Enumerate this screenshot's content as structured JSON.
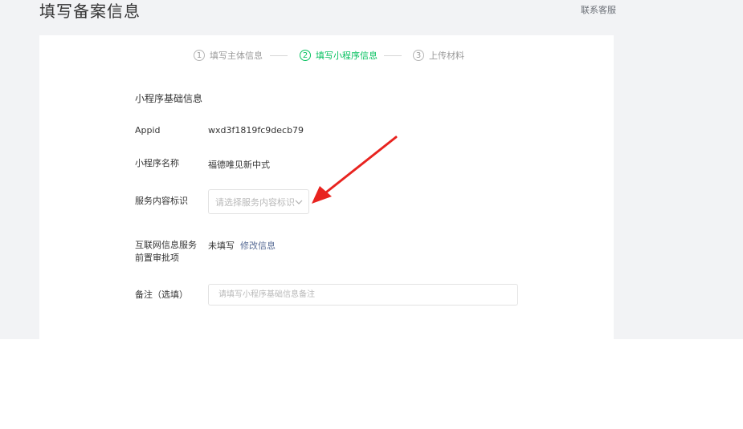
{
  "header": {
    "title": "填写备案信息",
    "contact_label": "联系客服"
  },
  "steps": [
    {
      "number": "1",
      "label": "填写主体信息",
      "active": false
    },
    {
      "number": "2",
      "label": "填写小程序信息",
      "active": true
    },
    {
      "number": "3",
      "label": "上传材料",
      "active": false
    }
  ],
  "section": {
    "title": "小程序基础信息"
  },
  "form": {
    "appid_label": "Appid",
    "appid_value": "wxd3f1819fc9decb79",
    "name_label": "小程序名称",
    "name_value": "福德唯见新中式",
    "service_label": "服务内容标识",
    "service_placeholder": "请选择服务内容标识",
    "preapproval_label_line1": "互联网信息服务",
    "preapproval_label_line2": "前置审批项",
    "preapproval_status": "未填写",
    "preapproval_link": "修改信息",
    "remark_label": "备注（选填）",
    "remark_placeholder": "请填写小程序基础信息备注"
  },
  "colors": {
    "accent": "#07c160",
    "link": "#576b95",
    "annotation_arrow": "#e8231f",
    "page_bg": "#f2f3f5"
  },
  "icons": {
    "select_chevron": "chevron-down-icon",
    "annotation": "red-arrow-icon"
  }
}
